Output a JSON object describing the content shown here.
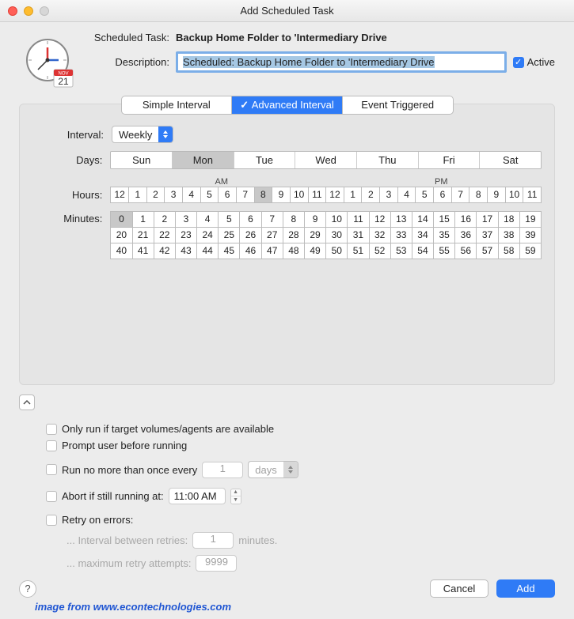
{
  "window": {
    "title": "Add Scheduled Task"
  },
  "header": {
    "task_label": "Scheduled Task:",
    "task_value": "Backup Home Folder to 'Intermediary Drive",
    "desc_label": "Description:",
    "desc_value": "Scheduled: Backup Home Folder to 'Intermediary Drive",
    "active_label": "Active",
    "active_checked": true,
    "calendar_month": "NOV",
    "calendar_day": "21"
  },
  "tabs": {
    "items": [
      {
        "label": "Simple Interval",
        "active": false
      },
      {
        "label": "Advanced Interval",
        "active": true,
        "check": "✓"
      },
      {
        "label": "Event Triggered",
        "active": false
      }
    ]
  },
  "interval": {
    "label": "Interval:",
    "value": "Weekly"
  },
  "days": {
    "label": "Days:",
    "items": [
      "Sun",
      "Mon",
      "Tue",
      "Wed",
      "Thu",
      "Fri",
      "Sat"
    ],
    "selected": [
      1
    ]
  },
  "hours": {
    "label": "Hours:",
    "am_label": "AM",
    "pm_label": "PM",
    "items": [
      "12",
      "1",
      "2",
      "3",
      "4",
      "5",
      "6",
      "7",
      "8",
      "9",
      "10",
      "11",
      "12",
      "1",
      "2",
      "3",
      "4",
      "5",
      "6",
      "7",
      "8",
      "9",
      "10",
      "11"
    ],
    "selected": [
      8
    ]
  },
  "minutes": {
    "label": "Minutes:",
    "items": [
      "0",
      "1",
      "2",
      "3",
      "4",
      "5",
      "6",
      "7",
      "8",
      "9",
      "10",
      "11",
      "12",
      "13",
      "14",
      "15",
      "16",
      "17",
      "18",
      "19",
      "20",
      "21",
      "22",
      "23",
      "24",
      "25",
      "26",
      "27",
      "28",
      "29",
      "30",
      "31",
      "32",
      "33",
      "34",
      "35",
      "36",
      "37",
      "38",
      "39",
      "40",
      "41",
      "42",
      "43",
      "44",
      "45",
      "46",
      "47",
      "48",
      "49",
      "50",
      "51",
      "52",
      "53",
      "54",
      "55",
      "56",
      "57",
      "58",
      "59"
    ],
    "selected": [
      0
    ]
  },
  "options": {
    "only_run_label": "Only run if target volumes/agents are available",
    "prompt_label": "Prompt user before running",
    "run_no_more_label": "Run no more than once every",
    "run_no_more_value": "1",
    "run_no_more_unit": "days",
    "abort_if_label": "Abort if still running at:",
    "abort_time": "11:00 AM",
    "retry_label": "Retry on errors:",
    "retry_interval_label": "... Interval between retries:",
    "retry_interval_value": "1",
    "retry_interval_unit": "minutes.",
    "retry_max_label": "... maximum retry attempts:",
    "retry_max_value": "9999"
  },
  "buttons": {
    "cancel": "Cancel",
    "add": "Add"
  },
  "watermark": "image from www.econtechnologies.com"
}
